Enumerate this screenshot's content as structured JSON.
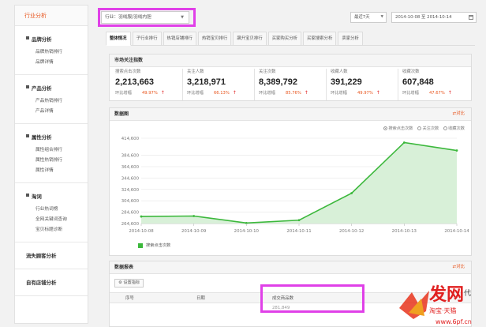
{
  "sidebar": {
    "head": "行业分析",
    "sections": [
      {
        "title": "品牌分析",
        "items": [
          "品牌热销排行",
          "品牌详情"
        ]
      },
      {
        "title": "产品分析",
        "items": [
          "产品热销排行",
          "产品详情"
        ]
      },
      {
        "title": "属性分析",
        "items": [
          "属性组合排行",
          "属性热销排行",
          "属性详情"
        ]
      },
      {
        "title": "淘词",
        "items": [
          "行业热词榜",
          "全网关键词查询",
          "宝贝标题诊断"
        ]
      }
    ],
    "plain": [
      "流失顾客分析",
      "自有店铺分析"
    ]
  },
  "topbar": {
    "industry": "行业：羽绒服/羽绒内胆",
    "period": "最近7天",
    "date_from": "2014-10-08",
    "date_sep": "至",
    "date_to": "2014-10-14"
  },
  "tabs": [
    "整体情况",
    "子行业排行",
    "热销店铺排行",
    "热销宝贝排行",
    "飙升宝贝排行",
    "买家购买分析",
    "买家搜索分析",
    "卖家分析"
  ],
  "market": {
    "title": "市场关注指数",
    "trend_label": "环比增幅",
    "metrics": [
      {
        "label": "搜索点击次数",
        "value": "2,213,663",
        "pct": "49.97%"
      },
      {
        "label": "关注人数",
        "value": "3,218,971",
        "pct": "66.13%"
      },
      {
        "label": "关注次数",
        "value": "8,389,792",
        "pct": "85.76%"
      },
      {
        "label": "收藏人数",
        "value": "391,229",
        "pct": "49.97%"
      },
      {
        "label": "收藏次数",
        "value": "607,848",
        "pct": "47.67%"
      }
    ]
  },
  "chart_panel": {
    "title": "数据图",
    "compare": "对比",
    "radios": [
      "搜索点击次数",
      "关注次数",
      "收藏次数"
    ]
  },
  "chart_data": {
    "type": "area",
    "x": [
      "2014-10-08",
      "2014-10-09",
      "2014-10-10",
      "2014-10-11",
      "2014-10-12",
      "2014-10-13",
      "2014-10-14"
    ],
    "series": [
      {
        "name": "搜索点击次数",
        "values": [
          277000,
          277800,
          265500,
          270500,
          318000,
          407000,
          393000
        ]
      }
    ],
    "yticks": [
      "264,600",
      "284,600",
      "304,600",
      "324,600",
      "344,600",
      "364,600",
      "384,600",
      "414,600"
    ],
    "ylim": [
      264600,
      414600
    ],
    "color": "#3cb83c",
    "fill": "#d8f0d8",
    "grid": true
  },
  "table_panel": {
    "title": "数据报表",
    "compare": "对比",
    "setting": "设置指标",
    "columns": [
      "序号",
      "日期",
      "成交商品数"
    ],
    "row_partial": [
      "",
      "",
      "281,849"
    ]
  },
  "brand": {
    "accent": "#e8541c",
    "highlight": "#e040e8"
  }
}
